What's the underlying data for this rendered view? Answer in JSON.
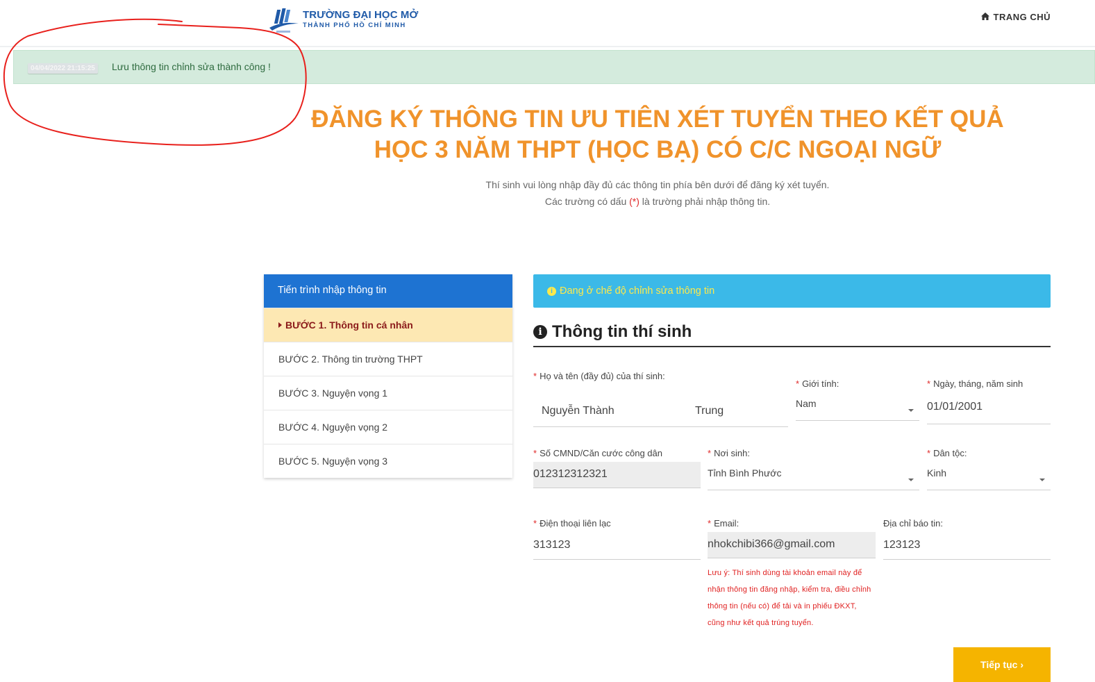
{
  "header": {
    "logo_line1": "TRƯỜNG ĐẠI HỌC MỞ",
    "logo_line2": "THÀNH PHỐ HỒ CHÍ MINH",
    "home_icon": "home-icon",
    "nav_home": "TRANG CHỦ"
  },
  "alert": {
    "timestamp": "04/04/2022 21:15:25",
    "message": "Lưu thông tin chỉnh sửa thành công !"
  },
  "page": {
    "title_line1": "ĐĂNG KÝ THÔNG TIN ƯU TIÊN XÉT TUYỂN THEO KẾT QUẢ",
    "title_line2": "HỌC 3 NĂM THPT (HỌC BẠ) CÓ C/C NGOẠI NGỮ",
    "subtitle_line1": "Thí sinh vui lòng nhập đầy đủ các thông tin phía bên dưới để đăng ký xét tuyển.",
    "subtitle_line2_a": "Các trường có dấu",
    "subtitle_line2_req": "(*)",
    "subtitle_line2_b": "là trường phải nhập thông tin."
  },
  "steps": {
    "header": "Tiến trình nhập thông tin",
    "items": [
      {
        "label": "BƯỚC 1. Thông tin cá nhân",
        "active": true
      },
      {
        "label": "BƯỚC 2. Thông tin trường THPT",
        "active": false
      },
      {
        "label": "BƯỚC 3. Nguyện vọng 1",
        "active": false
      },
      {
        "label": "BƯỚC 4. Nguyện vọng 2",
        "active": false
      },
      {
        "label": "BƯỚC 5. Nguyện vọng 3",
        "active": false
      }
    ]
  },
  "info_bar": {
    "icon": "info-circle-icon",
    "text": "Đang ở chế độ chỉnh sửa thông tin"
  },
  "form": {
    "section_title": "Thông tin thí sinh",
    "required_mark": "*",
    "full_name": {
      "label": "Họ và tên (đầy đủ) của thí sinh:",
      "last_middle": "Nguyễn Thành",
      "first": "Trung"
    },
    "gender": {
      "label": "Giới tính:",
      "value": "Nam"
    },
    "dob": {
      "label": "Ngày, tháng, năm sinh",
      "value": "01/01/2001"
    },
    "id_number": {
      "label": "Số CMND/Căn cước công dân",
      "value": "012312312321"
    },
    "birthplace": {
      "label": "Nơi sinh:",
      "value": "Tỉnh Bình Phước"
    },
    "ethnicity": {
      "label": "Dân tộc:",
      "value": "Kinh"
    },
    "phone": {
      "label": "Điện thoại liên lạc",
      "value": "313123"
    },
    "email": {
      "label": "Email:",
      "value": "nhokchibi366@gmail.com"
    },
    "address": {
      "label": "Địa chỉ báo tin:",
      "value": "123123"
    },
    "email_note": "Lưu ý: Thí sinh dùng tài khoản email này để nhận thông tin đăng nhập, kiểm tra, điều chỉnh thông tin (nếu có) để tải và in phiếu ĐKXT, cũng như kết quả trúng tuyển."
  },
  "next_button": "Tiếp tục ›",
  "colors": {
    "title_orange": "#f0932b",
    "step_header_blue": "#1e73d2",
    "info_bar_cyan": "#3bb9e8",
    "button_yellow": "#f5b400",
    "alert_green": "#d4ebdd",
    "required_red": "#e02b2b",
    "annotation_red": "#e8201c"
  }
}
